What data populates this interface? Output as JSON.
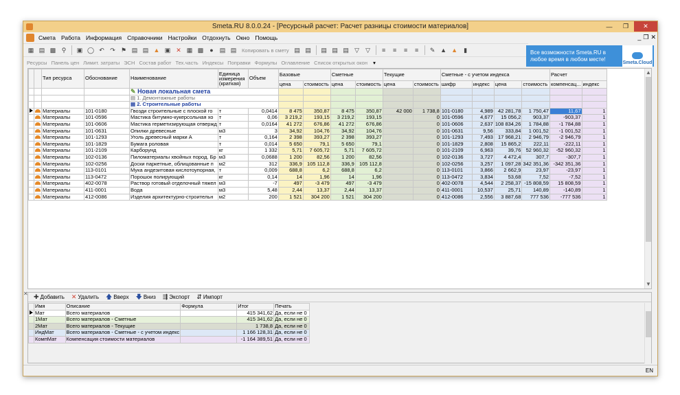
{
  "window": {
    "title": "Smeta.RU  8.0.0.24  - [Ресурсный расчет: Расчет разницы стоимости материалов]"
  },
  "menu": [
    "Смета",
    "Работа",
    "Информация",
    "Справочники",
    "Настройки",
    "Отдохнуть",
    "Окно",
    "Помощь"
  ],
  "toolbar": {
    "copy_to_estimate": "Копировать в смету"
  },
  "promo": {
    "text": "Все возможности Smeta.RU в любое время в любом месте!",
    "brand": "Smeta.Cloud"
  },
  "tabs": [
    "Ресурсы",
    "Панель цен",
    "Лимит. затраты",
    "ЭСН",
    "Состав работ",
    "Тех.часть",
    "Индексы",
    "Поправки",
    "Формулы",
    "Оглавление",
    "Список открытых окон"
  ],
  "grid": {
    "headers": {
      "type": "Тип ресурса",
      "basis": "Обоснование",
      "name": "Наименование",
      "unit": "Единица измерения (краткая)",
      "volume": "Объем",
      "base": "Базовые",
      "estimate": "Сметные",
      "current": "Текущие",
      "est_index": "Сметные - с учетом индекса",
      "calc": "Расчет",
      "price": "цена",
      "cost": "стоимость",
      "cipher": "шифр",
      "index": "индекс",
      "comp": "компенсац...",
      "index2": "индекс"
    },
    "sections": [
      "Новая локальная смета",
      "1. Демонтажные работы",
      "2. Строительные работы"
    ],
    "rows": [
      [
        "Материалы",
        "101-0180",
        "Гвозди строительные с плоской го",
        "т",
        "0,0414",
        "8 475",
        "350,87",
        "8 475",
        "350,87",
        "42 000",
        "1 738,8",
        "101-0180",
        "4,989",
        "42 281,78",
        "1 750,47",
        "11,67",
        "1"
      ],
      [
        "Материалы",
        "101-0596",
        "Мастика битумно-кукерсольная хо",
        "т",
        "0,06",
        "3 219,2",
        "193,15",
        "3 219,2",
        "193,15",
        "",
        "0",
        "101-0596",
        "4,677",
        "15 056,2",
        "903,37",
        "-903,37",
        "1"
      ],
      [
        "Материалы",
        "101-0606",
        "Мастика герметизирующая отвержд",
        "т",
        "0,0164",
        "41 272",
        "676,86",
        "41 272",
        "676,86",
        "",
        "0",
        "101-0606",
        "2,637",
        "108 834,26",
        "1 784,88",
        "-1 784,88",
        "1"
      ],
      [
        "Материалы",
        "101-0631",
        "Опилки древесные",
        "м3",
        "3",
        "34,92",
        "104,76",
        "34,92",
        "104,76",
        "",
        "0",
        "101-0631",
        "9,56",
        "333,84",
        "1 001,52",
        "-1 001,52",
        "1"
      ],
      [
        "Материалы",
        "101-1293",
        "Уголь древесный марки А",
        "т",
        "0,164",
        "2 398",
        "393,27",
        "2 398",
        "393,27",
        "",
        "0",
        "101-1293",
        "7,493",
        "17 968,21",
        "2 946,79",
        "-2 946,79",
        "1"
      ],
      [
        "Материалы",
        "101-1829",
        "Бумага роловая",
        "т",
        "0,014",
        "5 650",
        "79,1",
        "5 650",
        "79,1",
        "",
        "0",
        "101-1829",
        "2,808",
        "15 865,2",
        "222,11",
        "-222,11",
        "1"
      ],
      [
        "Материалы",
        "101-2109",
        "Карборунд",
        "кг",
        "1 332",
        "5,71",
        "7 605,72",
        "5,71",
        "7 605,72",
        "",
        "0",
        "101-2109",
        "6,963",
        "39,76",
        "52 960,32",
        "-52 960,32",
        "1"
      ],
      [
        "Материалы",
        "102-0136",
        "Пиломатериалы хвойных пород. Бр",
        "м3",
        "0,0688",
        "1 200",
        "82,56",
        "1 200",
        "82,56",
        "",
        "0",
        "102-0136",
        "3,727",
        "4 472,4",
        "307,7",
        "-307,7",
        "1"
      ],
      [
        "Материалы",
        "102-0256",
        "Доски паркетные, облицованные п",
        "м2",
        "312",
        "336,9",
        "105 112,8",
        "336,9",
        "105 112,8",
        "",
        "0",
        "102-0256",
        "3,257",
        "1 097,28",
        "342 351,36",
        "-342 351,36",
        "1"
      ],
      [
        "Материалы",
        "113-0101",
        "Мука андезитовая кислотоупорная,",
        "т",
        "0,009",
        "688,8",
        "6,2",
        "688,8",
        "6,2",
        "",
        "0",
        "113-0101",
        "3,866",
        "2 662,9",
        "23,97",
        "-23,97",
        "1"
      ],
      [
        "Материалы",
        "113-0472",
        "Порошок полирующий",
        "кг",
        "0,14",
        "14",
        "1,96",
        "14",
        "1,96",
        "",
        "0",
        "113-0472",
        "3,834",
        "53,68",
        "7,52",
        "-7,52",
        "1"
      ],
      [
        "Материалы",
        "402-0078",
        "Раствор готовый отделочный тяжел",
        "м3",
        "-7",
        "497",
        "-3 479",
        "497",
        "-3 479",
        "",
        "0",
        "402-0078",
        "4,544",
        "2 258,37",
        "-15 808,59",
        "15 808,59",
        "1"
      ],
      [
        "Материалы",
        "411-0001",
        "Вода",
        "м3",
        "5,48",
        "2,44",
        "13,37",
        "2,44",
        "13,37",
        "",
        "0",
        "411-0001",
        "10,537",
        "25,71",
        "140,89",
        "-140,89",
        "1"
      ],
      [
        "Материалы",
        "412-0086",
        "Изделия архитектурно-строительн",
        "м2",
        "200",
        "1 521",
        "304 200",
        "1 521",
        "304 200",
        "",
        "0",
        "412-0086",
        "2,556",
        "3 887,68",
        "777 536",
        "-777 536",
        "1"
      ]
    ]
  },
  "bottom": {
    "buttons": {
      "add": "Добавить",
      "delete": "Удалить",
      "up": "Вверх",
      "down": "Вниз",
      "export": "Экспорт",
      "import": "Импорт"
    },
    "headers": {
      "name": "Имя",
      "desc": "Описание",
      "formula": "Формула",
      "total": "Итог",
      "print": "Печать"
    },
    "rows": [
      [
        "Мат",
        "Всего материалов",
        "",
        "415 341,62",
        "Да, если не 0"
      ],
      [
        "1Мат",
        "Всего материалов - Сметные",
        "",
        "415 341,62",
        "Да, если не 0"
      ],
      [
        "2Мат",
        "Всего материалов - Текущие",
        "",
        "1 738,8",
        "Да, если не 0"
      ],
      [
        "ИндМат",
        "Всего материалов - Сметные - с учетом индекс",
        "",
        "1 166 128,31",
        "Да, если не 0"
      ],
      [
        "КомпМат",
        "Компенсация стоимости материалов",
        "",
        "-1 164 389,51",
        "Да, если не 0"
      ]
    ]
  },
  "status": {
    "lang": "EN"
  }
}
